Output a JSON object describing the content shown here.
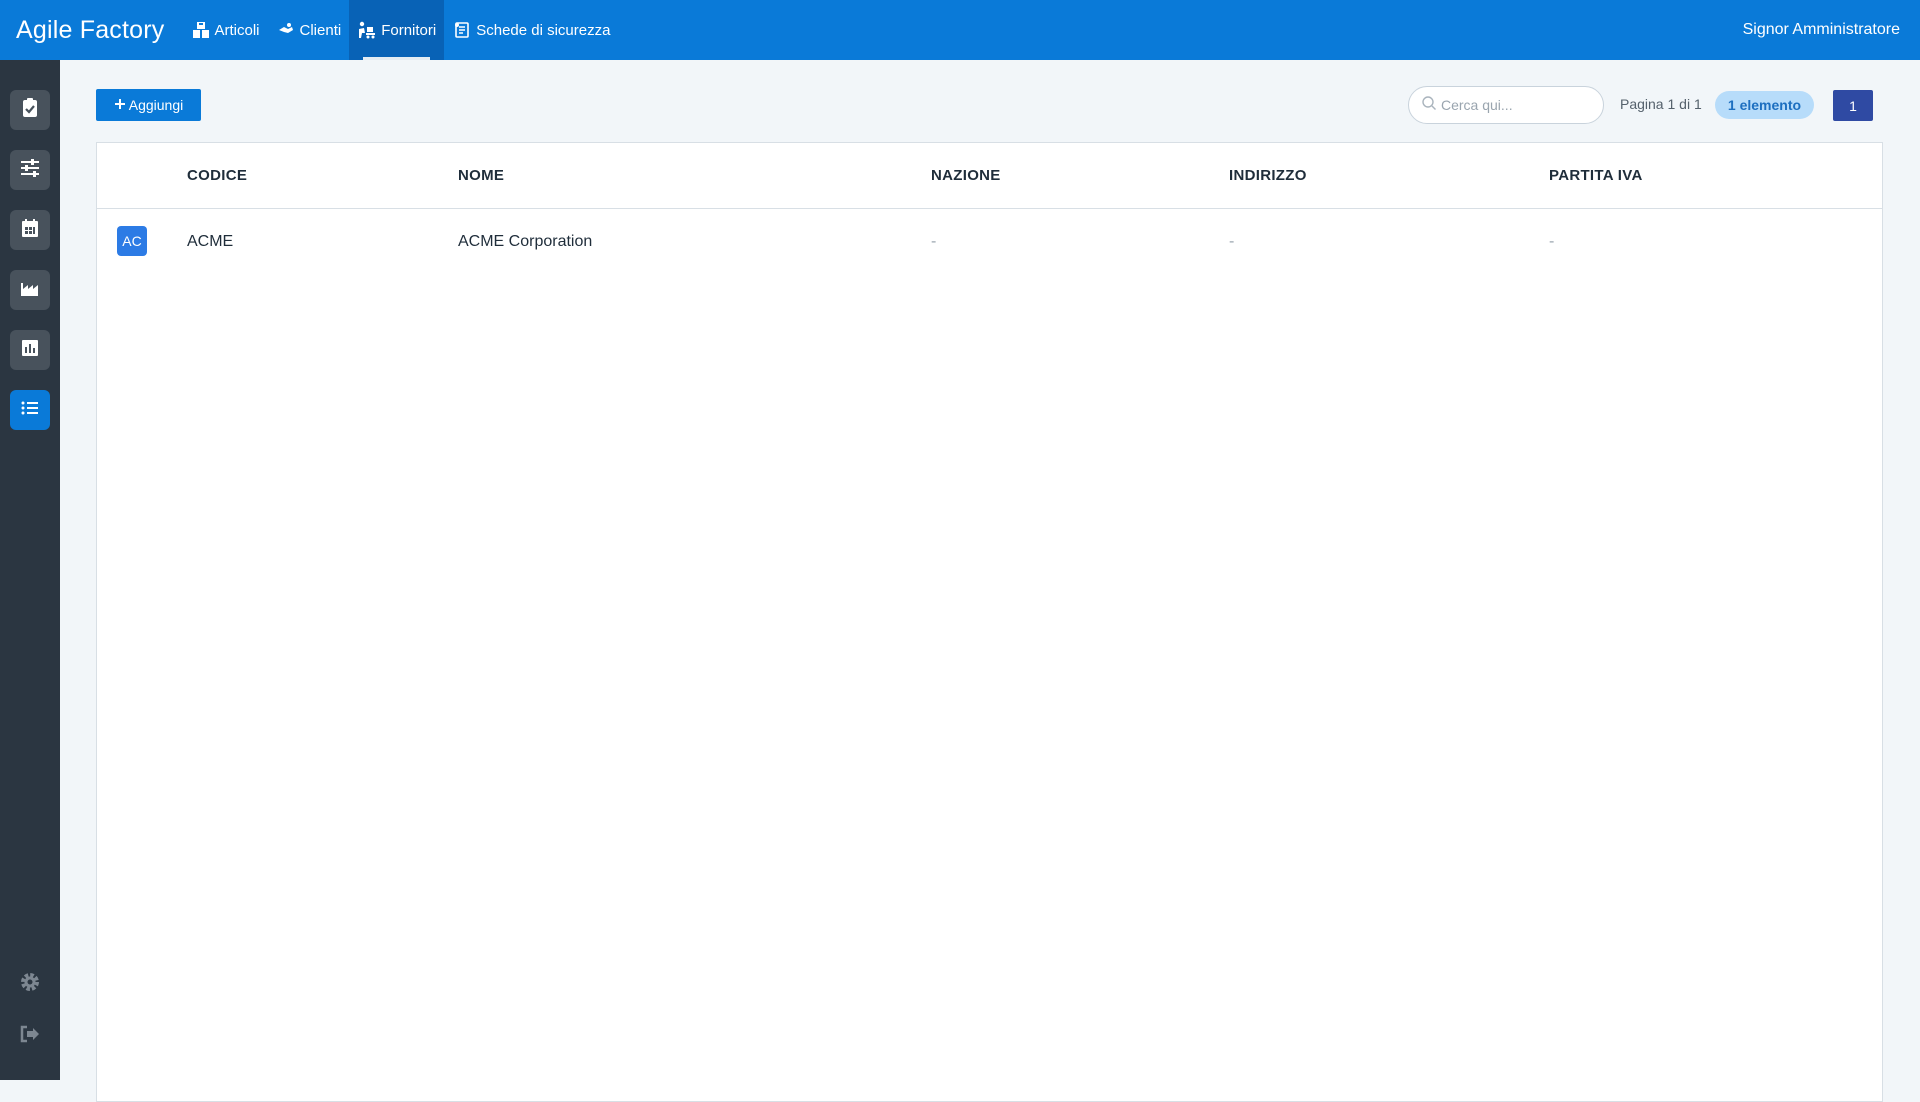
{
  "app": {
    "title": "Agile Factory",
    "user": "Signor Amministratore"
  },
  "nav": {
    "items": [
      {
        "label": "Articoli",
        "icon": "boxes-icon"
      },
      {
        "label": "Clienti",
        "icon": "handshake-icon"
      },
      {
        "label": "Fornitori",
        "icon": "supplier-icon",
        "active": true
      },
      {
        "label": "Schede di sicurezza",
        "icon": "safety-sheet-icon"
      }
    ]
  },
  "sidebar": {
    "items": [
      {
        "icon": "clipboard-check-icon"
      },
      {
        "icon": "sliders-icon"
      },
      {
        "icon": "calendar-icon"
      },
      {
        "icon": "factory-icon"
      },
      {
        "icon": "bar-chart-icon"
      },
      {
        "icon": "list-icon",
        "active": true
      }
    ],
    "bottom": [
      {
        "icon": "gear-icon"
      },
      {
        "icon": "logout-icon"
      }
    ]
  },
  "toolbar": {
    "add_label": "Aggiungi",
    "search_placeholder": "Cerca qui...",
    "page_info": "Pagina 1 di 1",
    "count_badge": "1 elemento",
    "current_page": "1"
  },
  "table": {
    "columns": [
      "CODICE",
      "NOME",
      "NAZIONE",
      "INDIRIZZO",
      "PARTITA IVA"
    ],
    "rows": [
      {
        "avatar": "AC",
        "codice": "ACME",
        "nome": "ACME Corporation",
        "nazione": "-",
        "indirizzo": "-",
        "partita_iva": "-"
      }
    ]
  },
  "colors": {
    "primary": "#0a7ad8",
    "sidebar": "#2b3641",
    "page_button": "#2f4aa3",
    "badge_bg": "#b7dcfa"
  }
}
